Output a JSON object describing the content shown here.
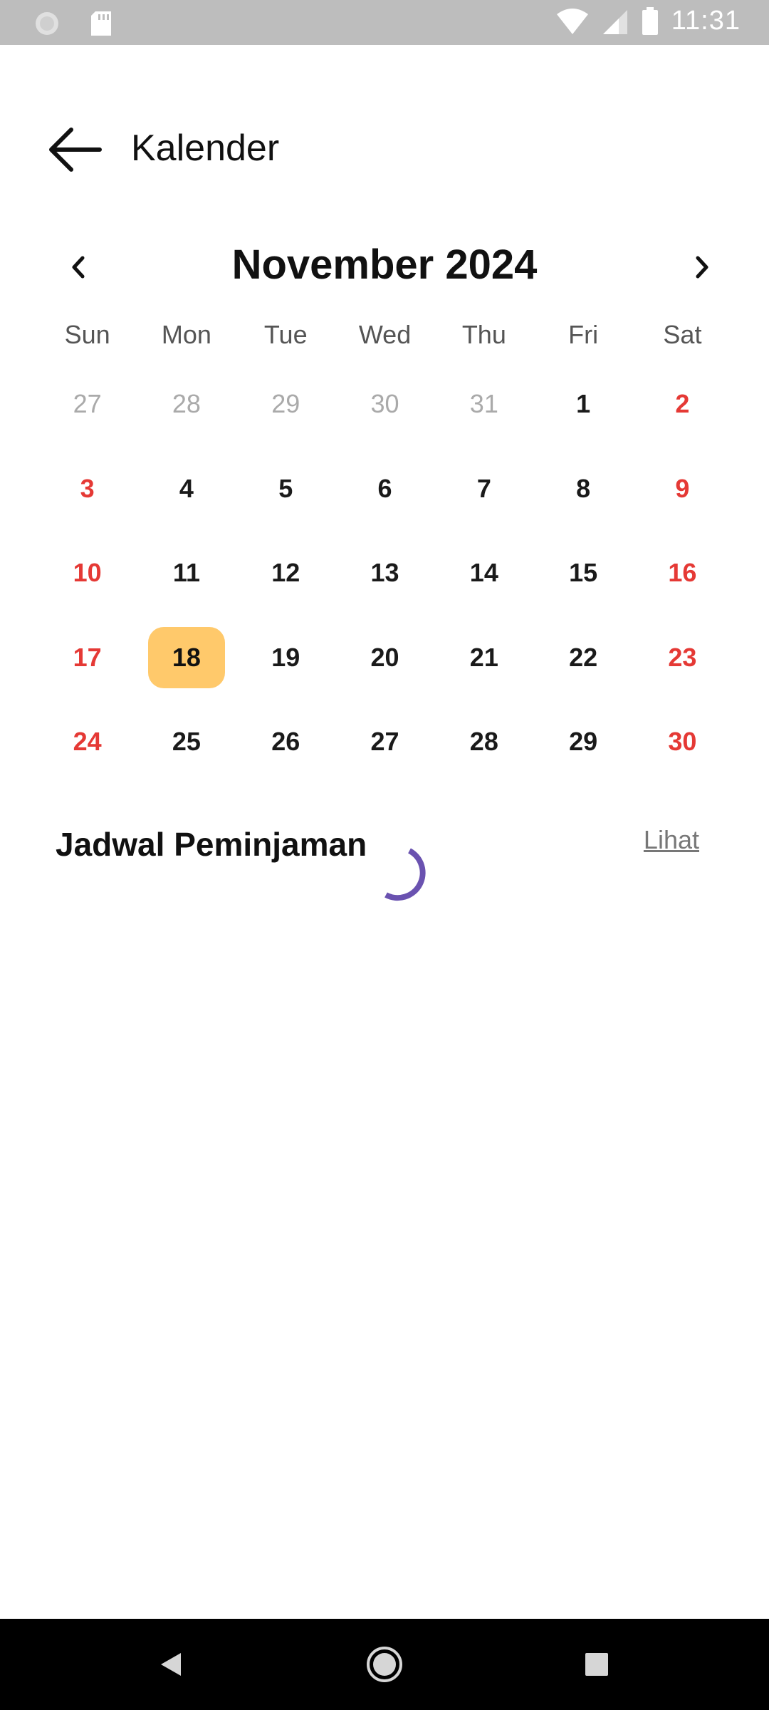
{
  "status_bar": {
    "time": "11:31",
    "icons": [
      "notification-icon",
      "sd-card-icon",
      "wifi-icon",
      "signal-icon",
      "battery-icon"
    ]
  },
  "app_bar": {
    "title": "Kalender",
    "back_icon": "arrow-left-icon"
  },
  "calendar": {
    "month_label": "November 2024",
    "prev_icon": "chevron-left-icon",
    "next_icon": "chevron-right-icon",
    "weekdays": [
      "Sun",
      "Mon",
      "Tue",
      "Wed",
      "Thu",
      "Fri",
      "Sat"
    ],
    "days": [
      "27",
      "28",
      "29",
      "30",
      "31",
      "1",
      "2",
      "3",
      "4",
      "5",
      "6",
      "7",
      "8",
      "9",
      "10",
      "11",
      "12",
      "13",
      "14",
      "15",
      "16",
      "17",
      "18",
      "19",
      "20",
      "21",
      "22",
      "23",
      "24",
      "25",
      "26",
      "27",
      "28",
      "29",
      "30"
    ],
    "selected_day": "18",
    "colors": {
      "weekend": "#e53935",
      "selected_bg": "#ffc96b",
      "outside": "#aaaaaa"
    }
  },
  "schedule": {
    "title": "Jadwal Peminjaman",
    "link_label": "Lihat",
    "loading": true,
    "spinner_color": "#6a52b0"
  },
  "nav_bar": {
    "icons": [
      "back-triangle-icon",
      "home-circle-icon",
      "recent-square-icon"
    ]
  }
}
